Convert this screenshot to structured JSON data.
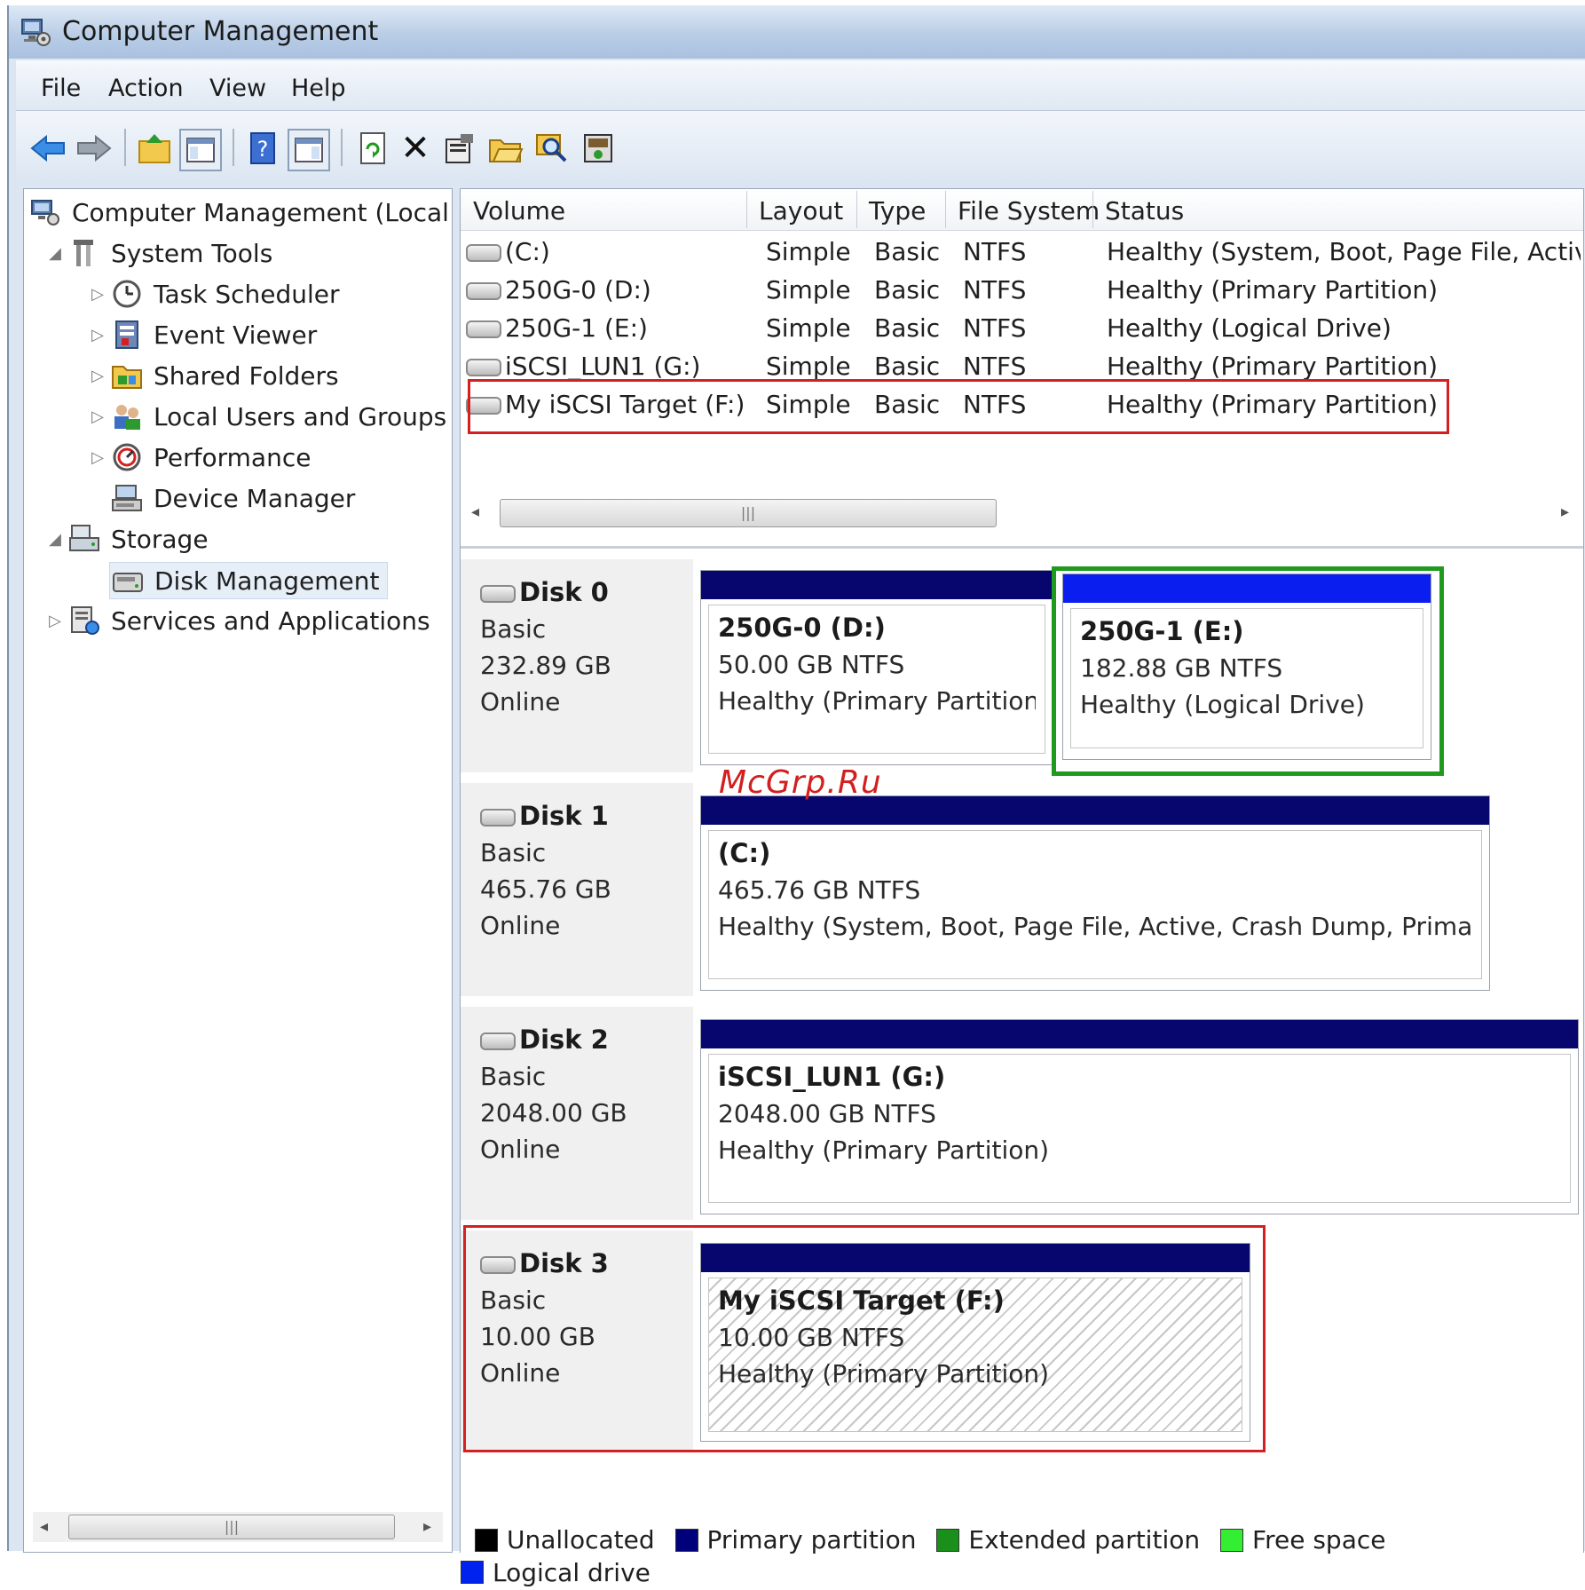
{
  "window": {
    "title": "Computer Management"
  },
  "menu": [
    "File",
    "Action",
    "View",
    "Help"
  ],
  "toolbar": [
    "back-icon",
    "forward-icon",
    "up-icon",
    "show-hide-console-tree-icon",
    "help-icon",
    "show-hide-action-pane-icon",
    "refresh-icon",
    "delete-icon",
    "properties-icon",
    "open-icon",
    "search-icon",
    "disk-icon"
  ],
  "tree": {
    "root": "Computer Management (Local",
    "system_tools": "System Tools",
    "task_scheduler": "Task Scheduler",
    "event_viewer": "Event Viewer",
    "shared_folders": "Shared Folders",
    "local_users": "Local Users and Groups",
    "performance": "Performance",
    "device_manager": "Device Manager",
    "storage": "Storage",
    "disk_management": "Disk Management",
    "services": "Services and Applications"
  },
  "volumes": {
    "headers": [
      "Volume",
      "Layout",
      "Type",
      "File System",
      "Status"
    ],
    "rows": [
      [
        "(C:)",
        "Simple",
        "Basic",
        "NTFS",
        "Healthy (System, Boot, Page File, Activ"
      ],
      [
        "250G-0 (D:)",
        "Simple",
        "Basic",
        "NTFS",
        "Healthy (Primary Partition)"
      ],
      [
        "250G-1 (E:)",
        "Simple",
        "Basic",
        "NTFS",
        "Healthy (Logical Drive)"
      ],
      [
        "iSCSI_LUN1 (G:)",
        "Simple",
        "Basic",
        "NTFS",
        "Healthy (Primary Partition)"
      ],
      [
        "My iSCSI Target (F:)",
        "Simple",
        "Basic",
        "NTFS",
        "Healthy (Primary Partition)"
      ]
    ]
  },
  "disks": [
    {
      "name": "Disk 0",
      "type": "Basic",
      "size": "232.89 GB",
      "state": "Online",
      "partitions": [
        {
          "title": "250G-0  (D:)",
          "size": "50.00 GB NTFS",
          "status": "Healthy (Primary Partition)"
        },
        {
          "title": "250G-1  (E:)",
          "size": "182.88 GB NTFS",
          "status": "Healthy (Logical Drive)"
        }
      ]
    },
    {
      "name": "Disk 1",
      "type": "Basic",
      "size": "465.76 GB",
      "state": "Online",
      "partitions": [
        {
          "title": "(C:)",
          "size": "465.76 GB NTFS",
          "status": "Healthy (System, Boot, Page File, Active, Crash Dump, Primary"
        }
      ]
    },
    {
      "name": "Disk 2",
      "type": "Basic",
      "size": "2048.00 GB",
      "state": "Online",
      "partitions": [
        {
          "title": "iSCSI_LUN1  (G:)",
          "size": "2048.00 GB NTFS",
          "status": "Healthy (Primary Partition)"
        }
      ]
    },
    {
      "name": "Disk 3",
      "type": "Basic",
      "size": "10.00 GB",
      "state": "Online",
      "partitions": [
        {
          "title": "My iSCSI Target  (F:)",
          "size": "10.00 GB NTFS",
          "status": "Healthy (Primary Partition)"
        }
      ]
    }
  ],
  "legend": [
    {
      "label": "Unallocated",
      "color": "#000000"
    },
    {
      "label": "Primary partition",
      "color": "#00007a"
    },
    {
      "label": "Extended partition",
      "color": "#1a8f1a"
    },
    {
      "label": "Free space",
      "color": "#33ee33"
    },
    {
      "label": "Logical drive",
      "color": "#0022ee"
    }
  ],
  "colors": {
    "primary_bar": "#06066e",
    "logical_bar": "#0a1ef0",
    "highlight_red": "#d42020",
    "highlight_green": "#1f9a1f"
  },
  "watermark": "McGrp.Ru"
}
